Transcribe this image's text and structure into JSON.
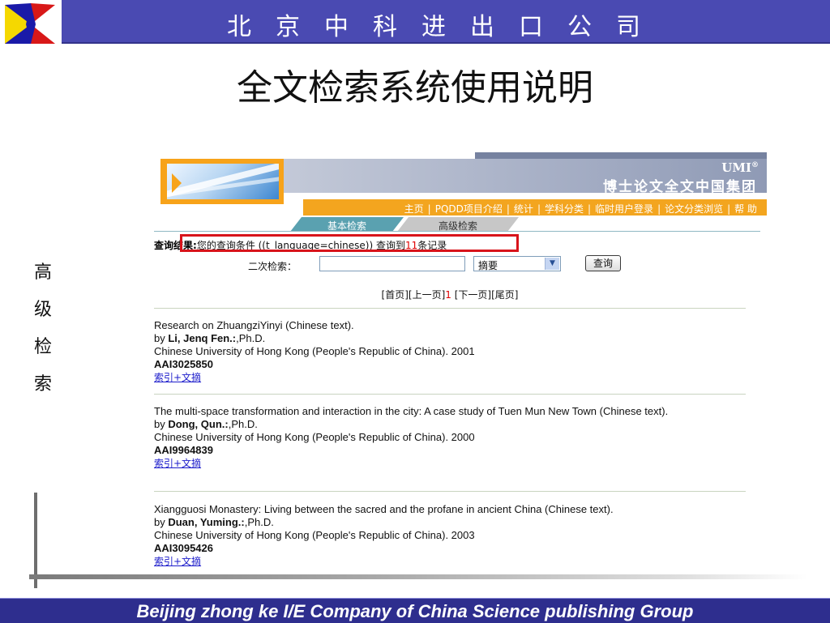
{
  "slide": {
    "company": "北京中科进出口公司",
    "title": "全文检索系统使用说明",
    "side_label": [
      "高",
      "级",
      "检",
      "索"
    ],
    "footer": "Beijing  zhong ke I/E Company of China Science publishing Group"
  },
  "site": {
    "brand": "UMI",
    "brand_reg": "®",
    "title": "博士论文全文中国集团",
    "nav": [
      "主页",
      "PQDD项目介绍",
      "统计",
      "学科分类",
      "临时用户登录",
      "论文分类浏览",
      "帮 助"
    ],
    "tabs": [
      "基本检索",
      "高级检索"
    ]
  },
  "query": {
    "label": "查询结果:",
    "text": "您的查询条件  ((t_language=chinese))  查询到",
    "count": "11",
    "suffix": "条记录"
  },
  "refine": {
    "label": "二次检索：",
    "input_value": "",
    "field": "摘要",
    "button": "查询"
  },
  "pager": {
    "first": "[首页]",
    "prev": "[上一页]",
    "current": "1",
    "next": "[下一页]",
    "last": "[尾页]"
  },
  "results": [
    {
      "title": "Research on ZhuangziYinyi (Chinese text).",
      "by": "by ",
      "authors": "Li, Jenq Fen.:",
      "degree": ",Ph.D.",
      "school": "Chinese University of Hong Kong (People's Republic of China). 2001",
      "accession": "AAI3025850",
      "link": "索引+文摘"
    },
    {
      "title": "The multi-space transformation and interaction in the city: A case study of Tuen Mun New Town (Chinese text).",
      "by": "by ",
      "authors": "Dong, Qun.:",
      "degree": ",Ph.D.",
      "school": "Chinese University of Hong Kong (People's Republic of China). 2000",
      "accession": "AAI9964839",
      "link": "索引+文摘"
    },
    {
      "title": "Xiangguosi Monastery: Living between the sacred and the profane in ancient China (Chinese text).",
      "by": "by ",
      "authors": "Duan, Yuming.:",
      "degree": ",Ph.D.",
      "school": "Chinese University of Hong Kong (People's Republic of China). 2003",
      "accession": "AAI3095426",
      "link": "索引+文摘"
    }
  ]
}
